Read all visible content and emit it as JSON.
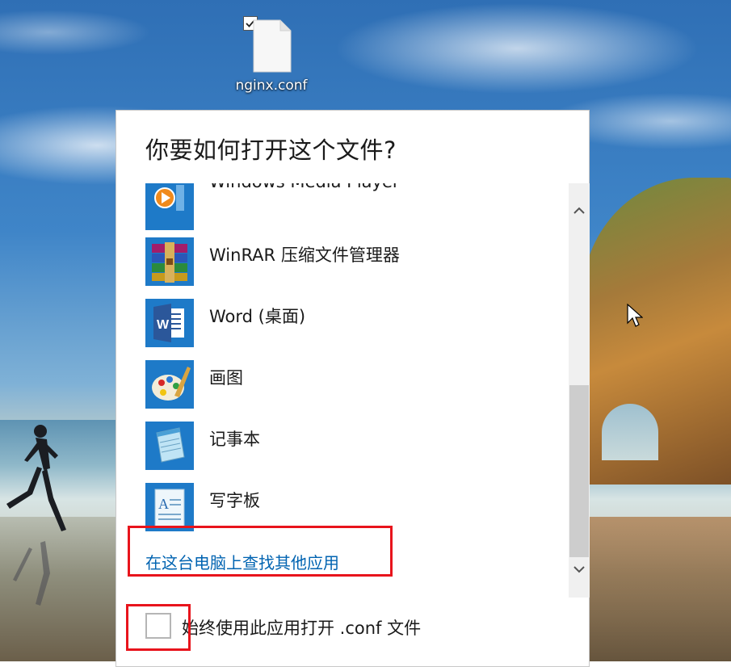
{
  "desktop": {
    "file": {
      "name": "nginx.conf",
      "checked": true,
      "icon": "document-icon"
    }
  },
  "dialog": {
    "title": "你要如何打开这个文件?",
    "apps": [
      {
        "label": "Windows Media Player",
        "icon": "media-player-icon",
        "color": "#1e7ac8"
      },
      {
        "label": "WinRAR 压缩文件管理器",
        "icon": "winrar-icon",
        "color": "#1e7ac8"
      },
      {
        "label": "Word (桌面)",
        "icon": "word-icon",
        "color": "#1e7ac8"
      },
      {
        "label": "画图",
        "icon": "paint-icon",
        "color": "#1e7ac8"
      },
      {
        "label": "记事本",
        "icon": "notepad-icon",
        "color": "#1e7ac8"
      },
      {
        "label": "写字板",
        "icon": "wordpad-icon",
        "color": "#1e7ac8"
      }
    ],
    "find_more_link": "在这台电脑上查找其他应用",
    "always_use_label": "始终使用此应用打开 .conf 文件",
    "always_use_checked": false
  },
  "colors": {
    "accent": "#0063b1",
    "tile_blue": "#1e7ac8",
    "annotation_red": "#e8141c"
  }
}
